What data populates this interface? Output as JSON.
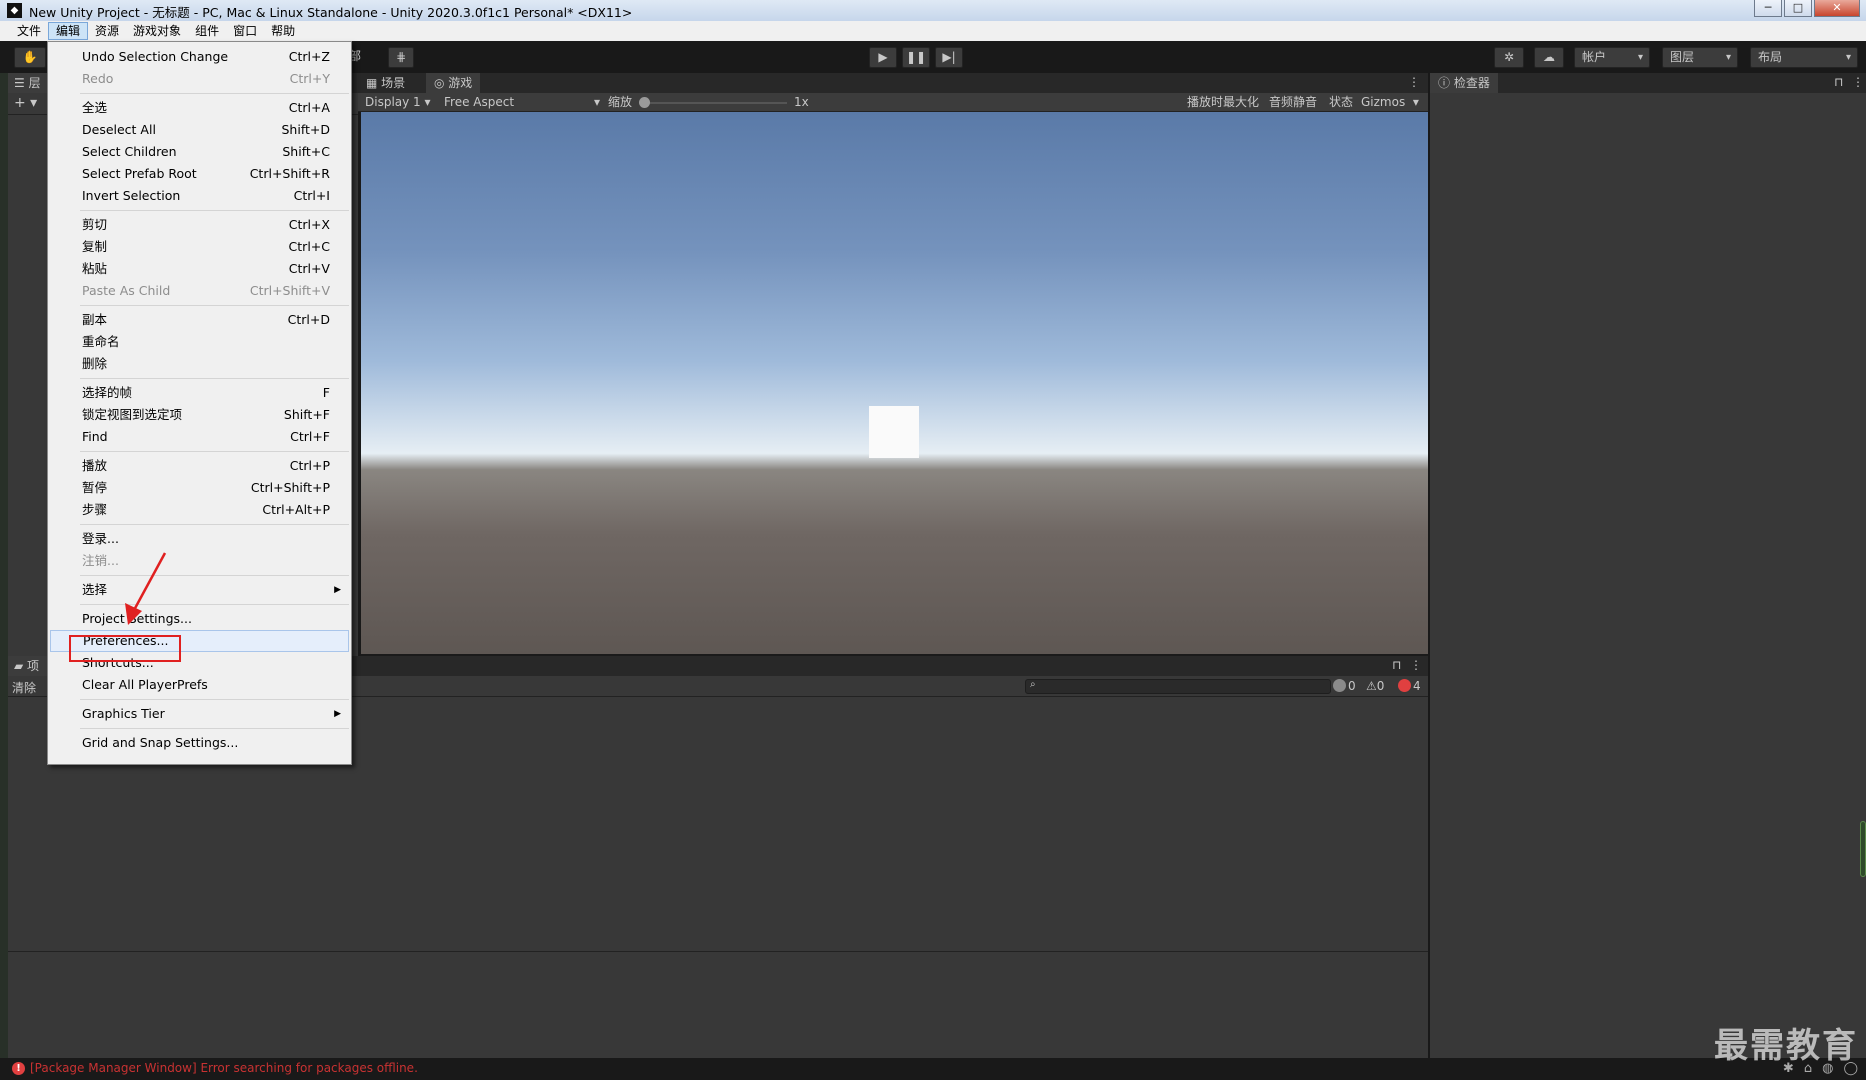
{
  "window": {
    "title": "New Unity Project - 无标题 - PC, Mac & Linux Standalone - Unity 2020.3.0f1c1 Personal* <DX11>",
    "buttons": {
      "minimize": "─",
      "maximize": "□",
      "close": "✕"
    }
  },
  "menubar": {
    "items": [
      "文件",
      "编辑",
      "资源",
      "游戏对象",
      "组件",
      "窗口",
      "帮助"
    ],
    "active_index": 1
  },
  "toolbar": {
    "hand_icon": "hand-icon",
    "pivot_label": "部",
    "account_label": "帐户",
    "layers_label": "图层",
    "layout_label": "布局"
  },
  "hierarchy": {
    "tab_label": "层",
    "add_label": "+ ▾"
  },
  "game": {
    "tabs": [
      {
        "icon": "grid-icon",
        "label": "场景"
      },
      {
        "icon": "gamepad-icon",
        "label": "游戏"
      }
    ],
    "display": "Display 1",
    "aspect": "Free Aspect",
    "scale_label": "缩放",
    "scale_value": "1x",
    "scale_fraction": 0.0,
    "maximize_on_play": "播放时最大化",
    "mute_audio": "音频静音",
    "stats": "状态",
    "gizmos": "Gizmos"
  },
  "console": {
    "tab_label": "项",
    "clear_label": "清除",
    "counts": {
      "info": "0",
      "warning": "0",
      "error": "4"
    }
  },
  "inspector": {
    "tab_label": "检查器"
  },
  "status": {
    "message": "[Package Manager Window] Error searching for packages offline."
  },
  "watermark": "最需教育",
  "edit_menu": {
    "groups": [
      [
        {
          "label": "Undo Selection Change",
          "shortcut": "Ctrl+Z"
        },
        {
          "label": "Redo",
          "shortcut": "Ctrl+Y",
          "disabled": true
        }
      ],
      [
        {
          "label": "全选",
          "shortcut": "Ctrl+A"
        },
        {
          "label": "Deselect All",
          "shortcut": "Shift+D"
        },
        {
          "label": "Select Children",
          "shortcut": "Shift+C"
        },
        {
          "label": "Select Prefab Root",
          "shortcut": "Ctrl+Shift+R"
        },
        {
          "label": "Invert Selection",
          "shortcut": "Ctrl+I"
        }
      ],
      [
        {
          "label": "剪切",
          "shortcut": "Ctrl+X"
        },
        {
          "label": "复制",
          "shortcut": "Ctrl+C"
        },
        {
          "label": "粘贴",
          "shortcut": "Ctrl+V"
        },
        {
          "label": "Paste As Child",
          "shortcut": "Ctrl+Shift+V",
          "disabled": true
        }
      ],
      [
        {
          "label": "副本",
          "shortcut": "Ctrl+D"
        },
        {
          "label": "重命名",
          "shortcut": ""
        },
        {
          "label": "删除",
          "shortcut": ""
        }
      ],
      [
        {
          "label": "选择的帧",
          "shortcut": "F"
        },
        {
          "label": "锁定视图到选定项",
          "shortcut": "Shift+F"
        },
        {
          "label": "Find",
          "shortcut": "Ctrl+F"
        }
      ],
      [
        {
          "label": "播放",
          "shortcut": "Ctrl+P"
        },
        {
          "label": "暂停",
          "shortcut": "Ctrl+Shift+P"
        },
        {
          "label": "步骤",
          "shortcut": "Ctrl+Alt+P"
        }
      ],
      [
        {
          "label": "登录...",
          "shortcut": ""
        },
        {
          "label": "注销...",
          "shortcut": "",
          "disabled": true
        }
      ],
      [
        {
          "label": "选择",
          "shortcut": "",
          "submenu": true
        }
      ],
      [
        {
          "label": "Project Settings...",
          "shortcut": ""
        },
        {
          "label": "Preferences...",
          "shortcut": "",
          "highlighted": true
        },
        {
          "label": "Shortcuts...",
          "shortcut": ""
        },
        {
          "label": "Clear All PlayerPrefs",
          "shortcut": ""
        }
      ],
      [
        {
          "label": "Graphics Tier",
          "shortcut": "",
          "submenu": true
        }
      ],
      [
        {
          "label": "Grid and Snap Settings...",
          "shortcut": ""
        }
      ]
    ]
  },
  "colors": {
    "annotation": "#e02020",
    "editor_bg": "#383838",
    "error": "#c83232"
  }
}
